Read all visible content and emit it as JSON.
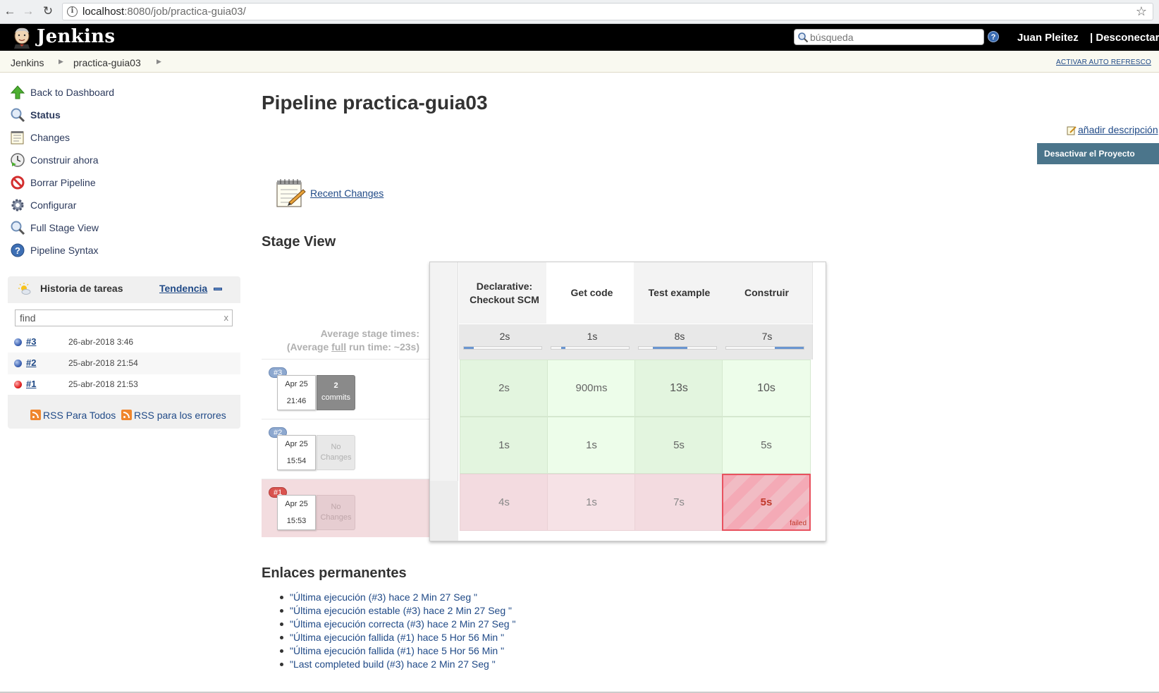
{
  "browser": {
    "url_host": "localhost",
    "url_path": ":8080/job/practica-guia03/"
  },
  "header": {
    "logo_text": "Jenkins",
    "search_placeholder": "búsqueda",
    "user_name": "Juan Pleitez",
    "logout_label": "| Desconectar"
  },
  "breadcrumb": {
    "items": [
      "Jenkins",
      "practica-guia03"
    ],
    "auto_refresh": "ACTIVAR AUTO REFRESCO"
  },
  "sidebar": {
    "tasks": [
      {
        "label": "Back to Dashboard",
        "icon": "up-arrow-icon"
      },
      {
        "label": "Status",
        "icon": "magnifier-icon"
      },
      {
        "label": "Changes",
        "icon": "notepad-icon"
      },
      {
        "label": "Construir ahora",
        "icon": "clock-play-icon"
      },
      {
        "label": "Borrar Pipeline",
        "icon": "no-entry-icon"
      },
      {
        "label": "Configurar",
        "icon": "gear-icon"
      },
      {
        "label": "Full Stage View",
        "icon": "magnifier-icon"
      },
      {
        "label": "Pipeline Syntax",
        "icon": "help-icon"
      }
    ],
    "history": {
      "title": "Historia de tareas",
      "trend_label": "Tendencia",
      "find_value": "find",
      "find_clear": "x",
      "builds": [
        {
          "number": "#3",
          "date": "26-abr-2018 3:46",
          "status": "blue"
        },
        {
          "number": "#2",
          "date": "25-abr-2018 21:54",
          "status": "blue"
        },
        {
          "number": "#1",
          "date": "25-abr-2018 21:53",
          "status": "red"
        }
      ],
      "rss_all": "RSS Para Todos",
      "rss_failures": "RSS para los errores"
    }
  },
  "main": {
    "title": "Pipeline practica-guia03",
    "add_description": "añadir descripción",
    "disable_button": "Desactivar el Proyecto",
    "recent_changes": "Recent Changes",
    "stage_view_title": "Stage View",
    "avg_label_line1": "Average stage times:",
    "avg_label_line2_pre": "(Average ",
    "avg_label_line2_full": "full",
    "avg_label_line2_post": " run time: ~23s)",
    "stages": [
      {
        "name": "Declarative: Checkout SCM",
        "avg": "2s",
        "bar_start": 0.0,
        "bar_width": 0.13
      },
      {
        "name": "Get code",
        "avg": "1s",
        "bar_start": 0.13,
        "bar_width": 0.05
      },
      {
        "name": "Test example",
        "avg": "8s",
        "bar_start": 0.18,
        "bar_width": 0.45
      },
      {
        "name": "Construir",
        "avg": "7s",
        "bar_start": 0.63,
        "bar_width": 0.37
      }
    ],
    "runs": [
      {
        "badge": "#3",
        "date": "Apr 25",
        "time": "21:46",
        "changes_count": "2",
        "changes_label": "commits",
        "status": "success",
        "durations": [
          "2s",
          "900ms",
          "13s",
          "10s"
        ]
      },
      {
        "badge": "#2",
        "date": "Apr 25",
        "time": "15:54",
        "changes_line1": "No",
        "changes_line2": "Changes",
        "status": "success",
        "durations": [
          "1s",
          "1s",
          "5s",
          "5s"
        ]
      },
      {
        "badge": "#1",
        "date": "Apr 25",
        "time": "15:53",
        "changes_line1": "No",
        "changes_line2": "Changes",
        "status": "failed",
        "durations": [
          "4s",
          "1s",
          "7s",
          "5s"
        ],
        "failed_label": "failed"
      }
    ],
    "permalinks_title": "Enlaces permanentes",
    "permalinks": [
      "\"Última ejecución (#3) hace 2 Min 27 Seg \"",
      "\"Última ejecución estable (#3) hace 2 Min 27 Seg \"",
      "\"Última ejecución correcta (#3) hace 2 Min 27 Seg \"",
      "\"Última ejecución fallida (#1) hace 5 Hor 56 Min \"",
      "\"Última ejecución fallida (#1) hace 5 Hor 56 Min \"",
      "\"Last completed build (#3) hace 2 Min 27 Seg \""
    ]
  },
  "colors": {
    "header_bg": "#000000",
    "link": "#204a87",
    "success_cell": "#e3f5df",
    "failed_cell": "#f4aab6",
    "disable_button": "#4b758b"
  }
}
